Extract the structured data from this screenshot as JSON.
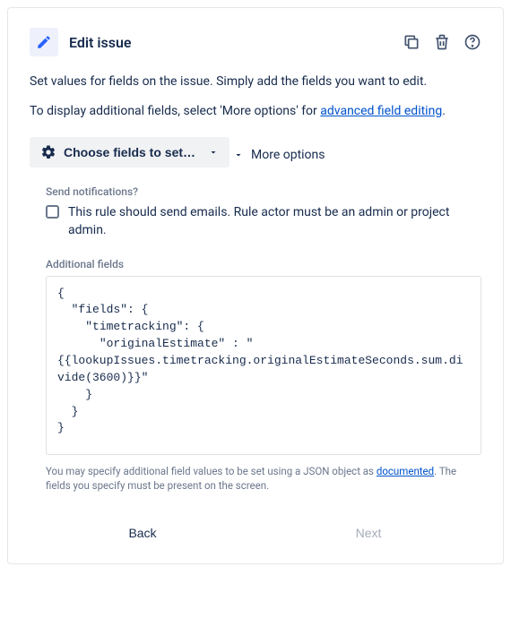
{
  "header": {
    "title": "Edit issue"
  },
  "description1": "Set values for fields on the issue. Simply add the fields you want to edit.",
  "description2_pre": "To display additional fields, select 'More options' for ",
  "description2_link": "advanced field editing",
  "description2_post": ".",
  "chooseFieldsButton": "Choose fields to set…",
  "moreOptionsLabel": "More options",
  "notifications": {
    "heading": "Send notifications?",
    "checkboxLabel": "This rule should send emails. Rule actor must be an admin or project admin."
  },
  "additionalFields": {
    "heading": "Additional fields",
    "value": "{\n  \"fields\": {\n    \"timetracking\": {\n      \"originalEstimate\" : \"{{lookupIssues.timetracking.originalEstimateSeconds.sum.divide(3600)}}\"\n    }\n  }\n}",
    "hint_pre": "You may specify additional field values to be set using a JSON object as ",
    "hint_link": "documented",
    "hint_post": ". The fields you specify must be present on the screen."
  },
  "footer": {
    "back": "Back",
    "next": "Next"
  }
}
